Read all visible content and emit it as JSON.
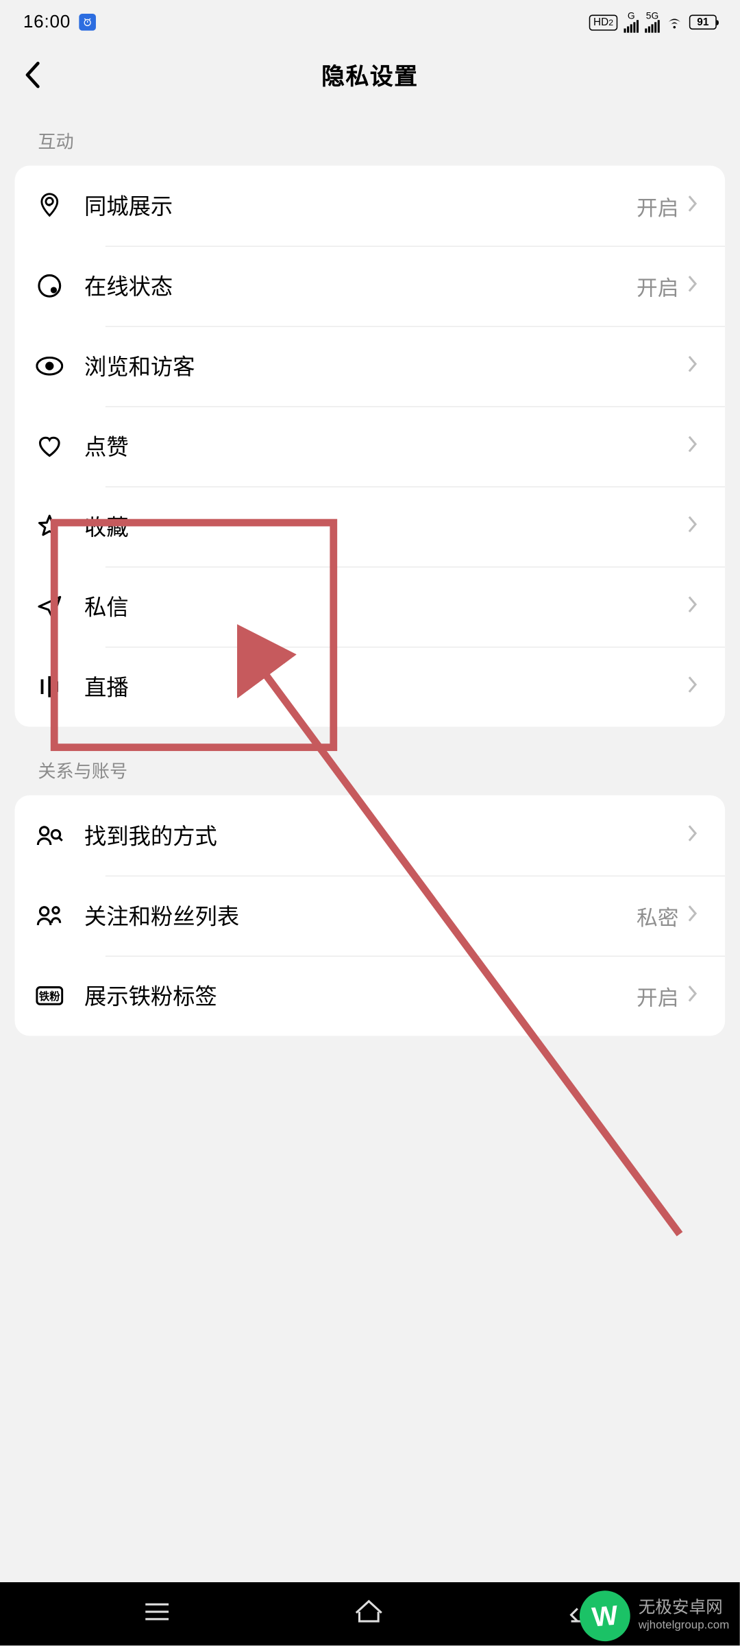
{
  "status": {
    "time": "16:00",
    "hd_label": "HD",
    "hd_sub": "2",
    "g_label": "G",
    "fiveg_label": "5G",
    "battery_pct": "91"
  },
  "header": {
    "title": "隐私设置"
  },
  "sections": {
    "interaction": {
      "label": "互动"
    },
    "relations": {
      "label": "关系与账号"
    }
  },
  "rows": {
    "local": {
      "label": "同城展示",
      "value": "开启"
    },
    "online": {
      "label": "在线状态",
      "value": "开启"
    },
    "browse": {
      "label": "浏览和访客",
      "value": ""
    },
    "like": {
      "label": "点赞",
      "value": ""
    },
    "fav": {
      "label": "收藏",
      "value": ""
    },
    "dm": {
      "label": "私信",
      "value": ""
    },
    "live": {
      "label": "直播",
      "value": ""
    },
    "findme": {
      "label": "找到我的方式",
      "value": ""
    },
    "follow": {
      "label": "关注和粉丝列表",
      "value": "私密"
    },
    "badge": {
      "label": "展示铁粉标签",
      "value": "开启"
    }
  },
  "watermark": {
    "logo_letter": "W",
    "line1": "无极安卓网",
    "line2": "wjhotelgroup.com"
  }
}
